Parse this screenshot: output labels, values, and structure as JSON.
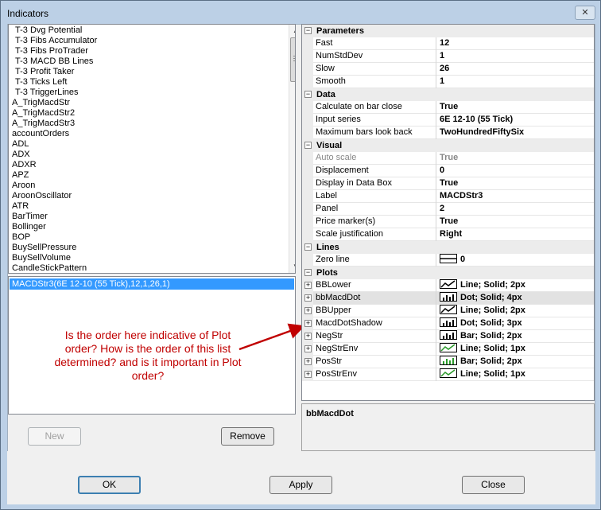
{
  "window": {
    "title": "Indicators",
    "close_glyph": "✕"
  },
  "indicator_list": [
    "T-3 Dvg Potential",
    "T-3 Fibs Accumulator",
    "T-3 Fibs ProTrader",
    "T-3 MACD BB Lines",
    "T-3 Profit Taker",
    "T-3 Ticks Left",
    "T-3 TriggerLines",
    "A_TrigMacdStr",
    "A_TrigMacdStr2",
    "A_TrigMacdStr3",
    "accountOrders",
    "ADL",
    "ADX",
    "ADXR",
    "APZ",
    "Aroon",
    "AroonOscillator",
    "ATR",
    "BarTimer",
    "Bollinger",
    "BOP",
    "BuySellPressure",
    "BuySellVolume",
    "CandleStickPattern"
  ],
  "selected_list": {
    "item": "MACDStr3(6E 12-10 (55 Tick),12,1,26,1)"
  },
  "annotation": {
    "text": "Is the order here indicative of Plot order? How is the order of this list determined? and is it important in Plot order?"
  },
  "buttons": {
    "new": "New",
    "remove": "Remove",
    "ok": "OK",
    "apply": "Apply",
    "close": "Close"
  },
  "properties": {
    "parameters": {
      "label": "Parameters",
      "rows": [
        {
          "name": "Fast",
          "value": "12"
        },
        {
          "name": "NumStdDev",
          "value": "1"
        },
        {
          "name": "Slow",
          "value": "26"
        },
        {
          "name": "Smooth",
          "value": "1"
        }
      ]
    },
    "data": {
      "label": "Data",
      "rows": [
        {
          "name": "Calculate on bar close",
          "value": "True"
        },
        {
          "name": "Input series",
          "value": "6E 12-10 (55 Tick)"
        },
        {
          "name": "Maximum bars look back",
          "value": "TwoHundredFiftySix"
        }
      ]
    },
    "visual": {
      "label": "Visual",
      "rows": [
        {
          "name": "Auto scale",
          "value": "True"
        },
        {
          "name": "Displacement",
          "value": "0"
        },
        {
          "name": "Display in Data Box",
          "value": "True"
        },
        {
          "name": "Label",
          "value": "MACDStr3"
        },
        {
          "name": "Panel",
          "value": "2"
        },
        {
          "name": "Price marker(s)",
          "value": "True"
        },
        {
          "name": "Scale justification",
          "value": "Right"
        }
      ]
    },
    "lines": {
      "label": "Lines",
      "rows": [
        {
          "name": "Zero line",
          "value": "0"
        }
      ]
    },
    "plots": {
      "label": "Plots",
      "rows": [
        {
          "name": "BBLower",
          "value": "Line; Solid; 2px",
          "icon": "line-plot-icon"
        },
        {
          "name": "bbMacdDot",
          "value": "Dot; Solid; 4px",
          "icon": "bar-plot-icon"
        },
        {
          "name": "BBUpper",
          "value": "Line; Solid; 2px",
          "icon": "line-plot-icon"
        },
        {
          "name": "MacdDotShadow",
          "value": "Dot; Solid; 3px",
          "icon": "bar-plot-icon"
        },
        {
          "name": "NegStr",
          "value": "Bar; Solid; 2px",
          "icon": "bar-plot-icon"
        },
        {
          "name": "NegStrEnv",
          "value": "Line; Solid; 1px",
          "icon": "line-plot-icon-green"
        },
        {
          "name": "PosStr",
          "value": "Bar; Solid; 2px",
          "icon": "bar-plot-icon-green"
        },
        {
          "name": "PosStrEnv",
          "value": "Line; Solid; 1px",
          "icon": "line-plot-icon-green"
        }
      ]
    }
  },
  "description": {
    "title": "bbMacdDot"
  },
  "colors": {
    "selection": "#3399ff",
    "annotation": "#c00000",
    "window_frame": "#bcd0e6"
  }
}
